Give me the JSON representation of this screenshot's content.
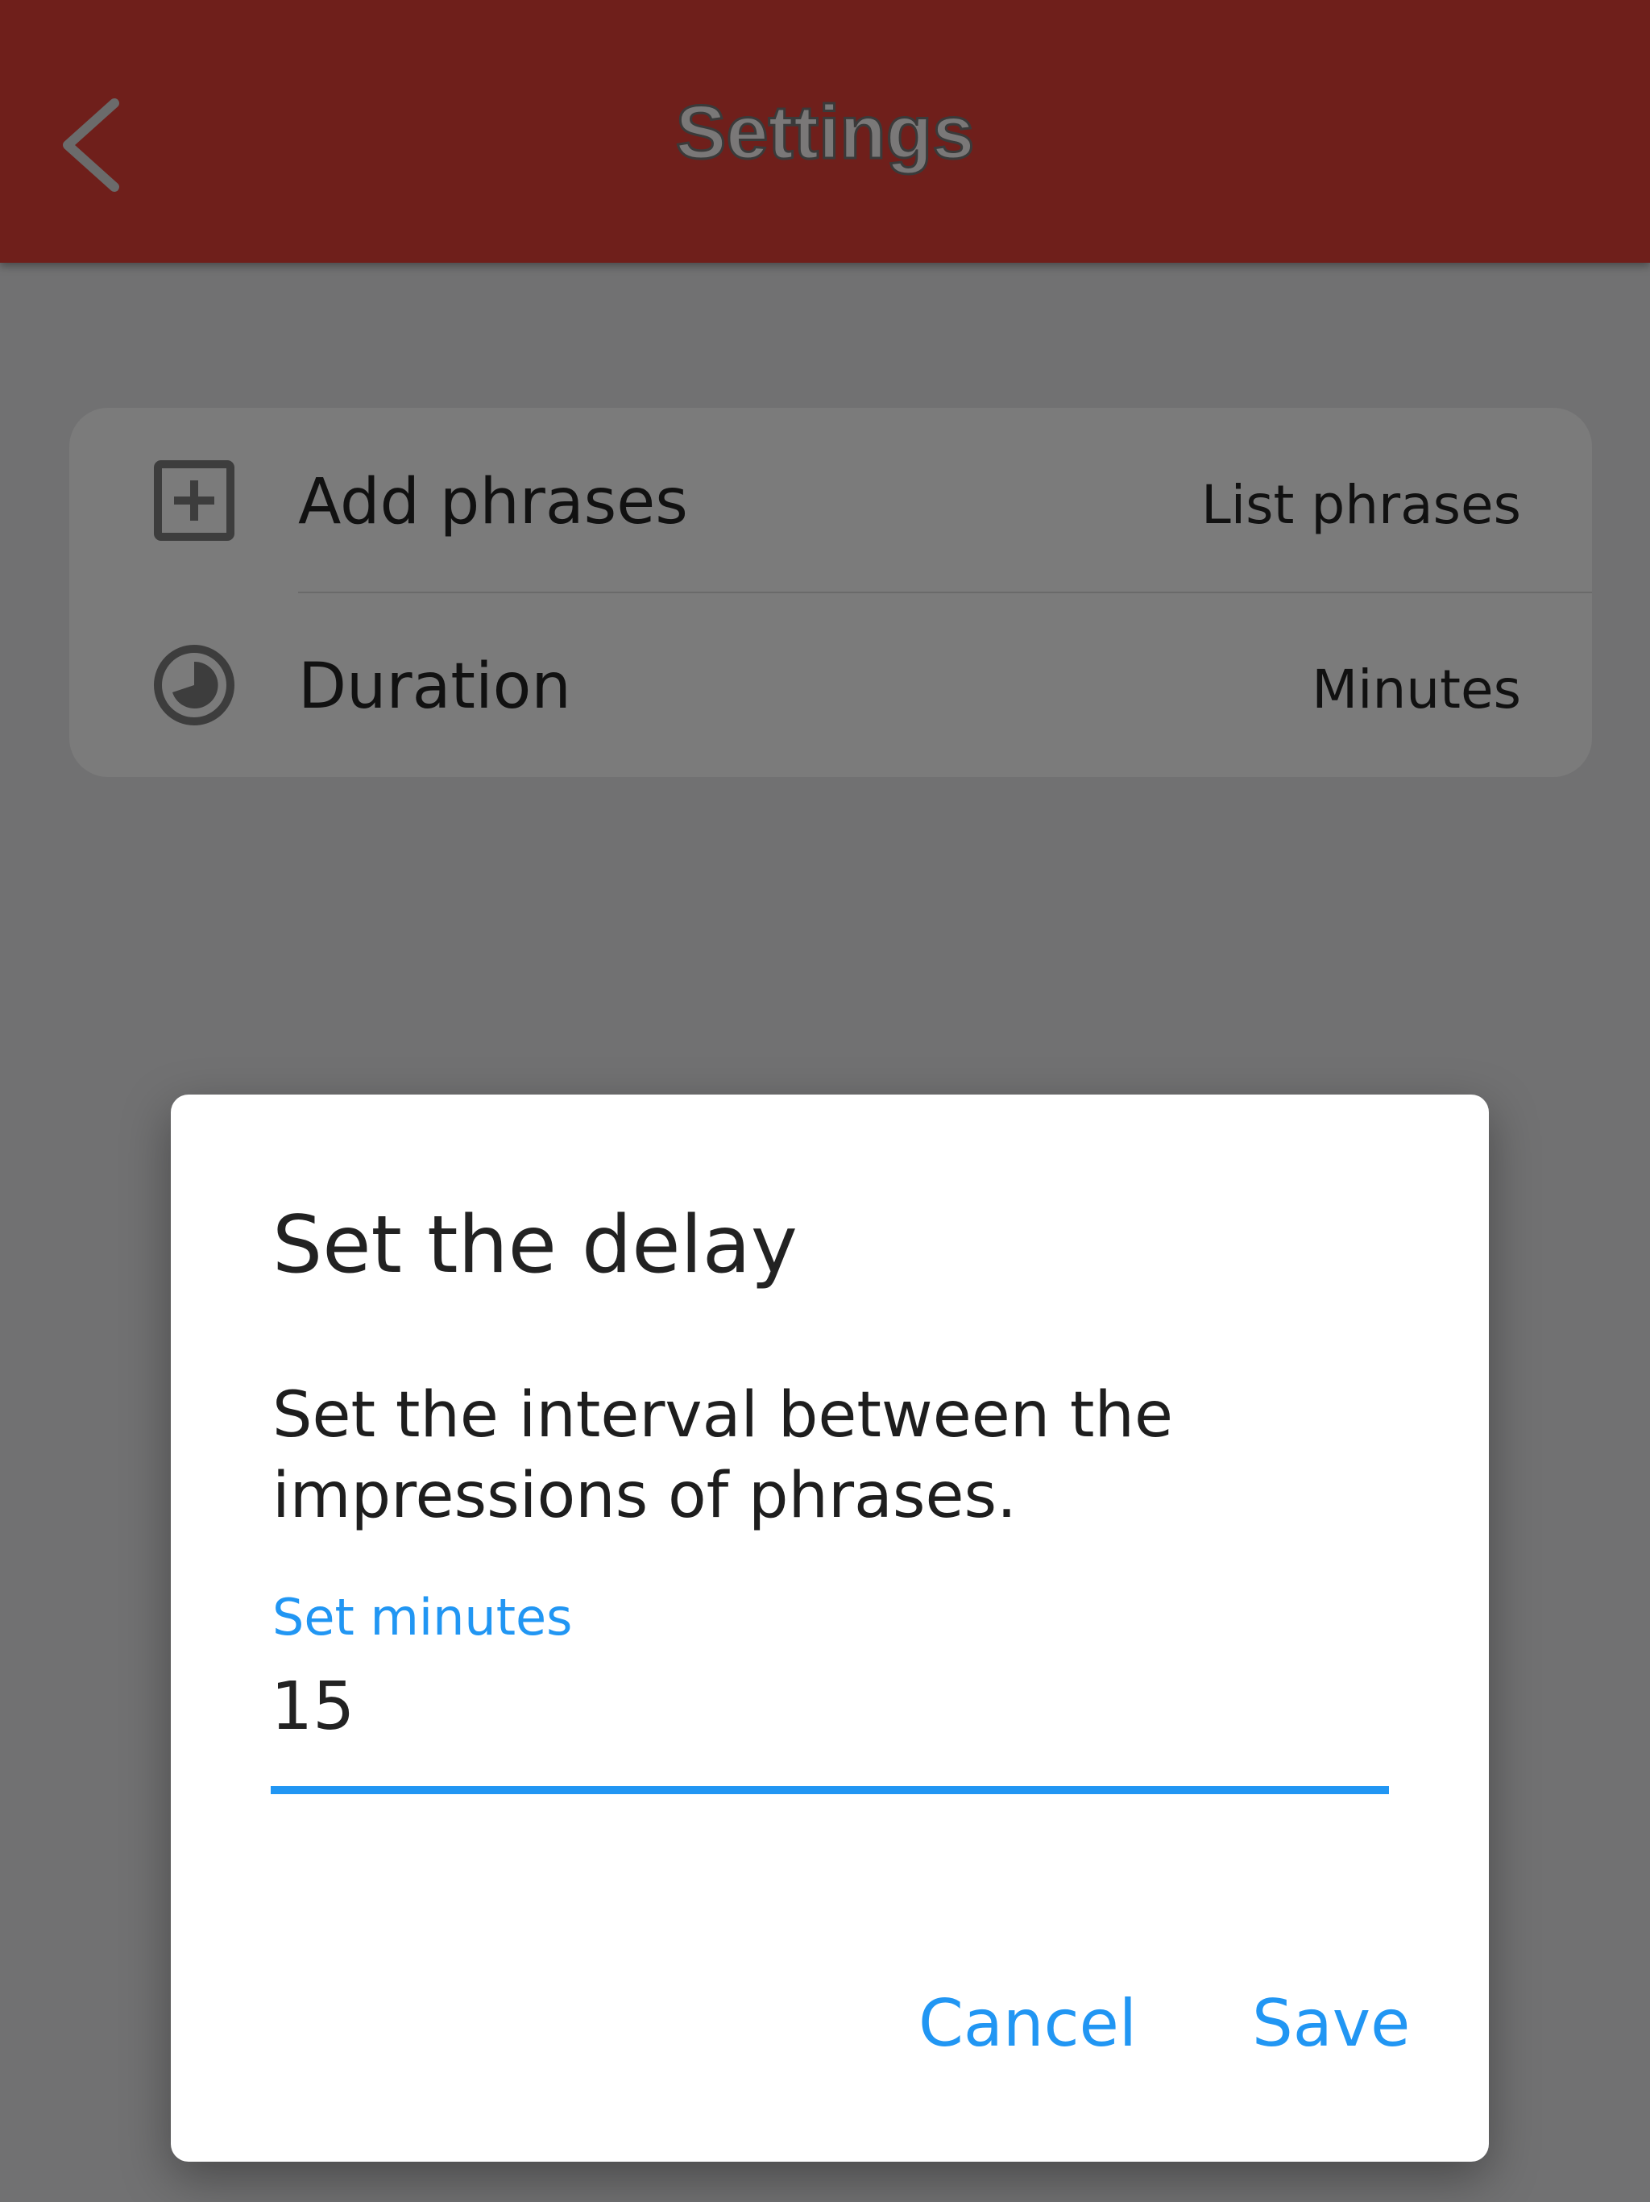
{
  "header": {
    "title": "Settings",
    "back_icon": "chevron-left-icon",
    "background_color": "#6f1f1b"
  },
  "settings": {
    "items": [
      {
        "icon": "add-box-icon",
        "label": "Add phrases",
        "value": "List phrases"
      },
      {
        "icon": "timelapse-icon",
        "label": "Duration",
        "value": "Minutes"
      }
    ]
  },
  "dialog": {
    "title": "Set the delay",
    "message": "Set the interval between the impressions of phrases.",
    "input": {
      "label": "Set minutes",
      "value": "15"
    },
    "cancel_label": "Cancel",
    "save_label": "Save",
    "accent_color": "#2196f3"
  }
}
